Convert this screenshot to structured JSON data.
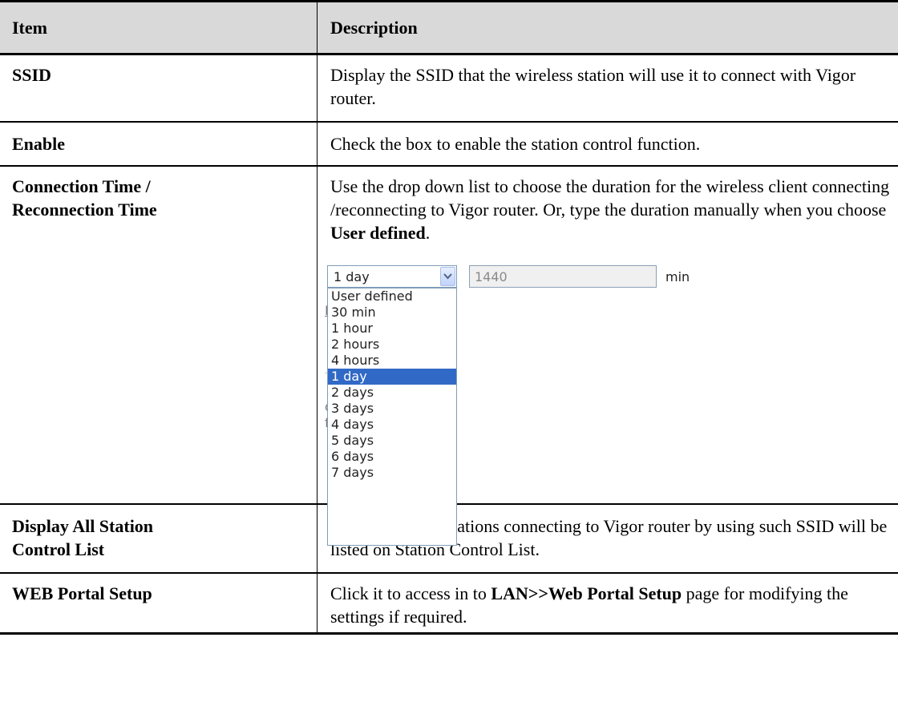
{
  "table": {
    "header": {
      "item": "Item",
      "description": "Description"
    },
    "rows": [
      {
        "item": "SSID",
        "description": "Display the SSID that the wireless station will use it to connect with Vigor router."
      },
      {
        "item": "Enable",
        "description": "Check the box to enable the station control function."
      },
      {
        "item_line1": "Connection Time /",
        "item_line2": "Reconnection Time",
        "description_prefix": "Use the drop down list to choose the duration for the wireless client connecting /reconnecting to Vigor router. Or, type the duration manually when you choose ",
        "description_bold": "User defined",
        "description_suffix": "."
      },
      {
        "item_line1": "Display All Station",
        "item_line2": "Control List",
        "description": "All the wireless stations connecting to Vigor router by using such SSID will be listed on Station Control List."
      },
      {
        "item": "WEB Portal Setup",
        "description_prefix": "Click it to access in to ",
        "description_bold": "LAN>>Web Portal Setup",
        "description_suffix": " page for modifying the settings if required."
      }
    ]
  },
  "screenshot": {
    "select_value": "1 day",
    "minutes_value": "1440",
    "unit": "min",
    "options": [
      "User defined",
      "30 min",
      "1 hour",
      "2 hours",
      "4 hours",
      "1 day",
      "2 days",
      "3 days",
      "4 days",
      "5 days",
      "6 days",
      "7 days"
    ],
    "selected_option": "1 day",
    "ghost_text": [
      "Li",
      "d,",
      "fi"
    ],
    "icons": {
      "dropdown": "chevron-down-icon"
    },
    "colors": {
      "highlight": "#3169c6",
      "border": "#7f9db9"
    }
  }
}
